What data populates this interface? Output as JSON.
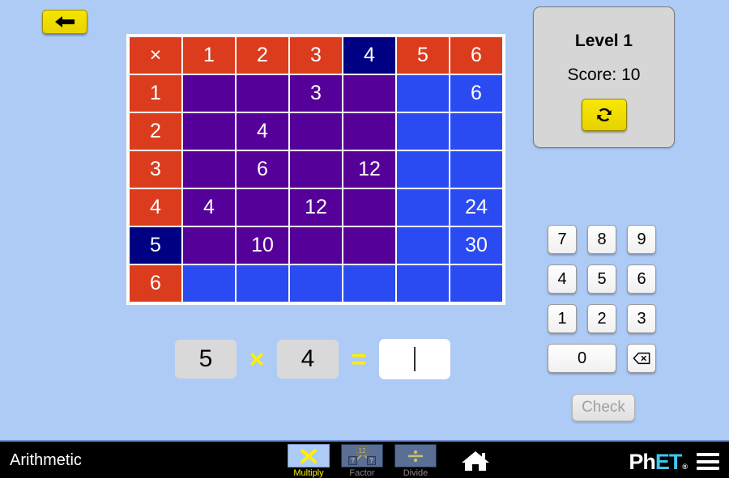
{
  "app": {
    "title": "Arithmetic",
    "background_color": "#AECBF5"
  },
  "back_button": {
    "name": "back-button",
    "icon": "left-arrow-icon"
  },
  "level_panel": {
    "level_label": "Level 1",
    "score_label": "Score: 10",
    "refresh_icon": "refresh-icon"
  },
  "table": {
    "corner_symbol": "×",
    "col_headers": [
      "1",
      "2",
      "3",
      "4",
      "5",
      "6"
    ],
    "row_headers": [
      "1",
      "2",
      "3",
      "4",
      "5",
      "6"
    ],
    "selected_col_index": 3,
    "selected_row_index": 4,
    "colors": {
      "header": "#DC3C1E",
      "header_selected": "#000082",
      "header_selected_text": "#FFF000",
      "cell_filled": "#550099",
      "cell_empty": "#2B4BF2"
    },
    "rows": [
      {
        "header": "1",
        "cells": [
          {
            "value": "",
            "state": "purple"
          },
          {
            "value": "",
            "state": "purple"
          },
          {
            "value": "3",
            "state": "purple"
          },
          {
            "value": "",
            "state": "purple"
          },
          {
            "value": "",
            "state": "blue"
          },
          {
            "value": "6",
            "state": "blue"
          }
        ]
      },
      {
        "header": "2",
        "cells": [
          {
            "value": "",
            "state": "purple"
          },
          {
            "value": "4",
            "state": "purple"
          },
          {
            "value": "",
            "state": "purple"
          },
          {
            "value": "",
            "state": "purple"
          },
          {
            "value": "",
            "state": "blue"
          },
          {
            "value": "",
            "state": "blue"
          }
        ]
      },
      {
        "header": "3",
        "cells": [
          {
            "value": "",
            "state": "purple"
          },
          {
            "value": "6",
            "state": "purple"
          },
          {
            "value": "",
            "state": "purple"
          },
          {
            "value": "12",
            "state": "purple"
          },
          {
            "value": "",
            "state": "blue"
          },
          {
            "value": "",
            "state": "blue"
          }
        ]
      },
      {
        "header": "4",
        "cells": [
          {
            "value": "4",
            "state": "purple"
          },
          {
            "value": "",
            "state": "purple"
          },
          {
            "value": "12",
            "state": "purple"
          },
          {
            "value": "",
            "state": "purple"
          },
          {
            "value": "",
            "state": "blue"
          },
          {
            "value": "24",
            "state": "blue"
          }
        ]
      },
      {
        "header": "5",
        "cells": [
          {
            "value": "",
            "state": "purple"
          },
          {
            "value": "10",
            "state": "purple"
          },
          {
            "value": "",
            "state": "purple"
          },
          {
            "value": "",
            "state": "purple"
          },
          {
            "value": "",
            "state": "blue"
          },
          {
            "value": "30",
            "state": "blue"
          }
        ]
      },
      {
        "header": "6",
        "cells": [
          {
            "value": "",
            "state": "blue"
          },
          {
            "value": "",
            "state": "blue"
          },
          {
            "value": "",
            "state": "blue"
          },
          {
            "value": "",
            "state": "blue"
          },
          {
            "value": "",
            "state": "blue"
          },
          {
            "value": "",
            "state": "blue"
          }
        ]
      }
    ]
  },
  "equation": {
    "left_operand": "5",
    "operator": "×",
    "right_operand": "4",
    "equals": "=",
    "answer_value": "",
    "answer_placeholder": "",
    "operator_color": "#FFF000"
  },
  "keypad": {
    "rows": [
      [
        "7",
        "8",
        "9"
      ],
      [
        "4",
        "5",
        "6"
      ],
      [
        "1",
        "2",
        "3"
      ]
    ],
    "zero_label": "0",
    "backspace_icon": "backspace-icon"
  },
  "check_button": {
    "label": "Check",
    "enabled": false
  },
  "bottom_bar": {
    "title": "Arithmetic",
    "screens": [
      {
        "label": "Multiply",
        "icon": "multiply-icon",
        "active": true
      },
      {
        "label": "Factor",
        "icon": "factor-icon",
        "active": false
      },
      {
        "label": "Divide",
        "icon": "divide-icon",
        "active": false
      }
    ],
    "factor_icon": {
      "product": "12",
      "left_question": "?",
      "right_question": "?"
    },
    "divide_icon_symbol": "÷",
    "home_icon": "home-icon",
    "logo": {
      "ph": "Ph",
      "et": "ET",
      "registered": "®"
    },
    "menu_icon": "hamburger-menu-icon"
  }
}
